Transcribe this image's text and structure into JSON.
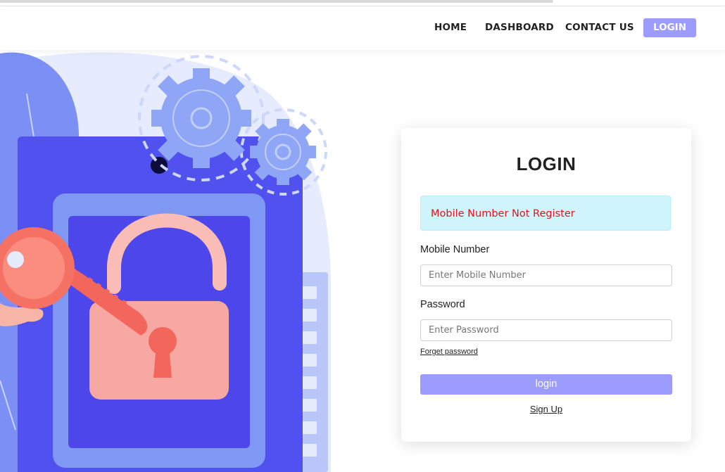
{
  "nav": {
    "home": "HOME",
    "dashboard": "DASHBOARD",
    "contact": "CONTACT US",
    "login": "LOGIN"
  },
  "login_card": {
    "title": "LOGIN",
    "alert": "Mobile Number Not Register",
    "mobile_label": "Mobile Number",
    "mobile_placeholder": "Enter Mobile Number",
    "password_label": "Password",
    "password_placeholder": "Enter Password",
    "forget_password": "Forget password",
    "submit": "login",
    "signup": "Sign Up"
  },
  "colors": {
    "accent": "#9c9cff",
    "alert_bg": "#cff4fc",
    "alert_text": "#e0141e",
    "illustration_blue": "#5050ee",
    "key_coral": "#fa6f5f"
  },
  "illustration": {
    "subject": "open padlock with key and gears"
  }
}
